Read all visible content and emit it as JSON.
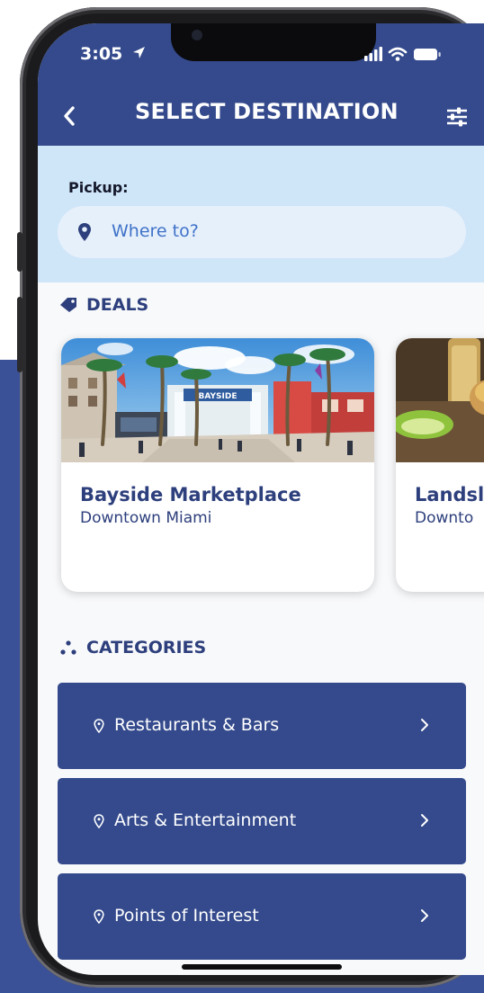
{
  "status_bar": {
    "time": "3:05"
  },
  "header": {
    "title": "SELECT DESTINATION"
  },
  "pickup": {
    "label": "Pickup:",
    "placeholder": "Where to?"
  },
  "deals": {
    "heading": "DEALS",
    "cards": [
      {
        "title": "Bayside Marketplace",
        "subtitle": "Downtown Miami",
        "sign_text": "BAYSIDE"
      },
      {
        "title": "Landsl",
        "subtitle": "Downto"
      }
    ]
  },
  "categories": {
    "heading": "CATEGORIES",
    "items": [
      {
        "label": "Restaurants & Bars"
      },
      {
        "label": "Arts & Entertainment"
      },
      {
        "label": "Points of Interest"
      }
    ]
  },
  "colors": {
    "brand_navy": "#344a8c",
    "pickup_bg": "#cfe5f8",
    "text_blue": "#2d3f7c",
    "placeholder_blue": "#3f72c8"
  },
  "icons": [
    "location-arrow-icon",
    "signal-icon",
    "wifi-icon",
    "battery-icon",
    "back-chevron-icon",
    "filter-icon",
    "map-pin-icon",
    "tag-icon",
    "dots-icon",
    "chevron-right-icon"
  ]
}
